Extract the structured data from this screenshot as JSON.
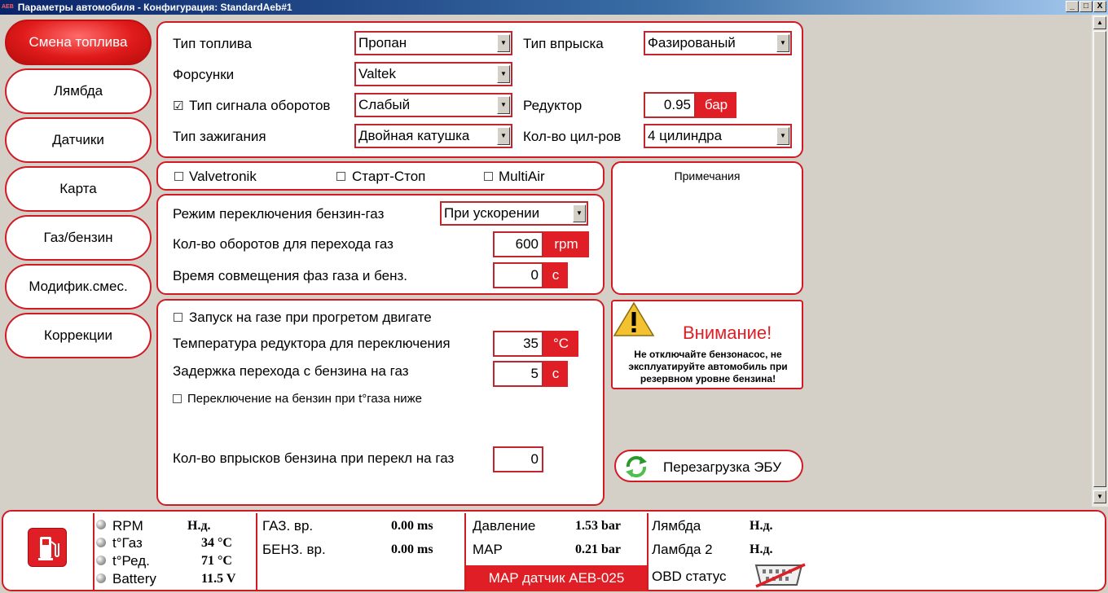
{
  "window": {
    "app_mark": "AEB",
    "title": "Параметры автомобиля - Конфигурация: StandardAeb#1",
    "minimize": "_",
    "maximize": "□",
    "close": "X"
  },
  "nav": [
    {
      "label": "Смена топлива",
      "active": true
    },
    {
      "label": "Лямбда"
    },
    {
      "label": "Датчики"
    },
    {
      "label": "Карта"
    },
    {
      "label": "Газ/бензин"
    },
    {
      "label": "Модифик.смес."
    },
    {
      "label": "Коррекции"
    }
  ],
  "fuel": {
    "fuel_type_label": "Тип топлива",
    "fuel_type_value": "Пропан",
    "injection_type_label": "Тип впрыска",
    "injection_type_value": "Фазированый",
    "injectors_label": "Форсунки",
    "injectors_value": "Valtek",
    "rpm_signal_checked": "☑",
    "rpm_signal_label": "Тип сигнала оборотов",
    "rpm_signal_value": "Слабый",
    "reducer_label": "Редуктор",
    "reducer_value": "0.95",
    "reducer_unit": "бар",
    "ignition_label": "Тип зажигания",
    "ignition_value": "Двойная катушка",
    "cylinders_label": "Кол-во цил-ров",
    "cylinders_value": "4 цилиндра"
  },
  "options": {
    "valvetronik": "Valvetronik",
    "start_stop": "Старт-Стоп",
    "multiair": "MultiAir"
  },
  "switching": {
    "mode_label": "Режим переключения бензин-газ",
    "mode_value": "При ускорении",
    "rpm_label": "Кол-во оборотов для перехода газ",
    "rpm_value": "600",
    "rpm_unit": "rpm",
    "overlap_label": "Время совмещения фаз газа и бенз.",
    "overlap_value": "0",
    "overlap_unit": "с"
  },
  "notes": {
    "title": "Примечания"
  },
  "start": {
    "start_gas_label": "Запуск на газе при прогретом двигате",
    "reducer_temp_label": "Температура редуктора для переключения",
    "reducer_temp_value": "35",
    "reducer_temp_unit": "°C",
    "delay_label": "Задержка перехода с бензина на газ",
    "delay_value": "5",
    "delay_unit": "с",
    "petrol_switch_label": "Переключение на бензин при t°газа ниже",
    "injections_label": "Кол-во впрысков бензина при перекл на газ",
    "injections_value": "0"
  },
  "warning": {
    "title": "Внимание!",
    "text": "Не отключайте бензонасос, не эксплуатируйте автомобиль при резервном уровне бензина!"
  },
  "reset_button": "Перезагрузка ЭБУ",
  "status": {
    "rpm_label": "RPM",
    "rpm_value": "Н.д.",
    "tgas_label": "t°Газ",
    "tgas_value": "34 °C",
    "tred_label": "t°Ред.",
    "tred_value": "71 °C",
    "battery_label": "Battery",
    "battery_value": "11.5 V",
    "gas_time_label": "ГАЗ. вр.",
    "gas_time_value": "0.00 ms",
    "petrol_time_label": "БЕНЗ. вр.",
    "petrol_time_value": "0.00 ms",
    "pressure_label": "Давление",
    "pressure_value": "1.53 bar",
    "map_label": "MAP",
    "map_value": "0.21 bar",
    "map_sensor": "MAP датчик AEB-025",
    "lambda_label": "Лямбда",
    "lambda_value": "Н.д.",
    "lambda2_label": "Ламбда 2",
    "lambda2_value": "Н.д.",
    "obd_label": "OBD статус"
  },
  "colors": {
    "accent": "#d11b24",
    "unit_bg": "#e01e26",
    "window_bg": "#d4d0c8"
  }
}
